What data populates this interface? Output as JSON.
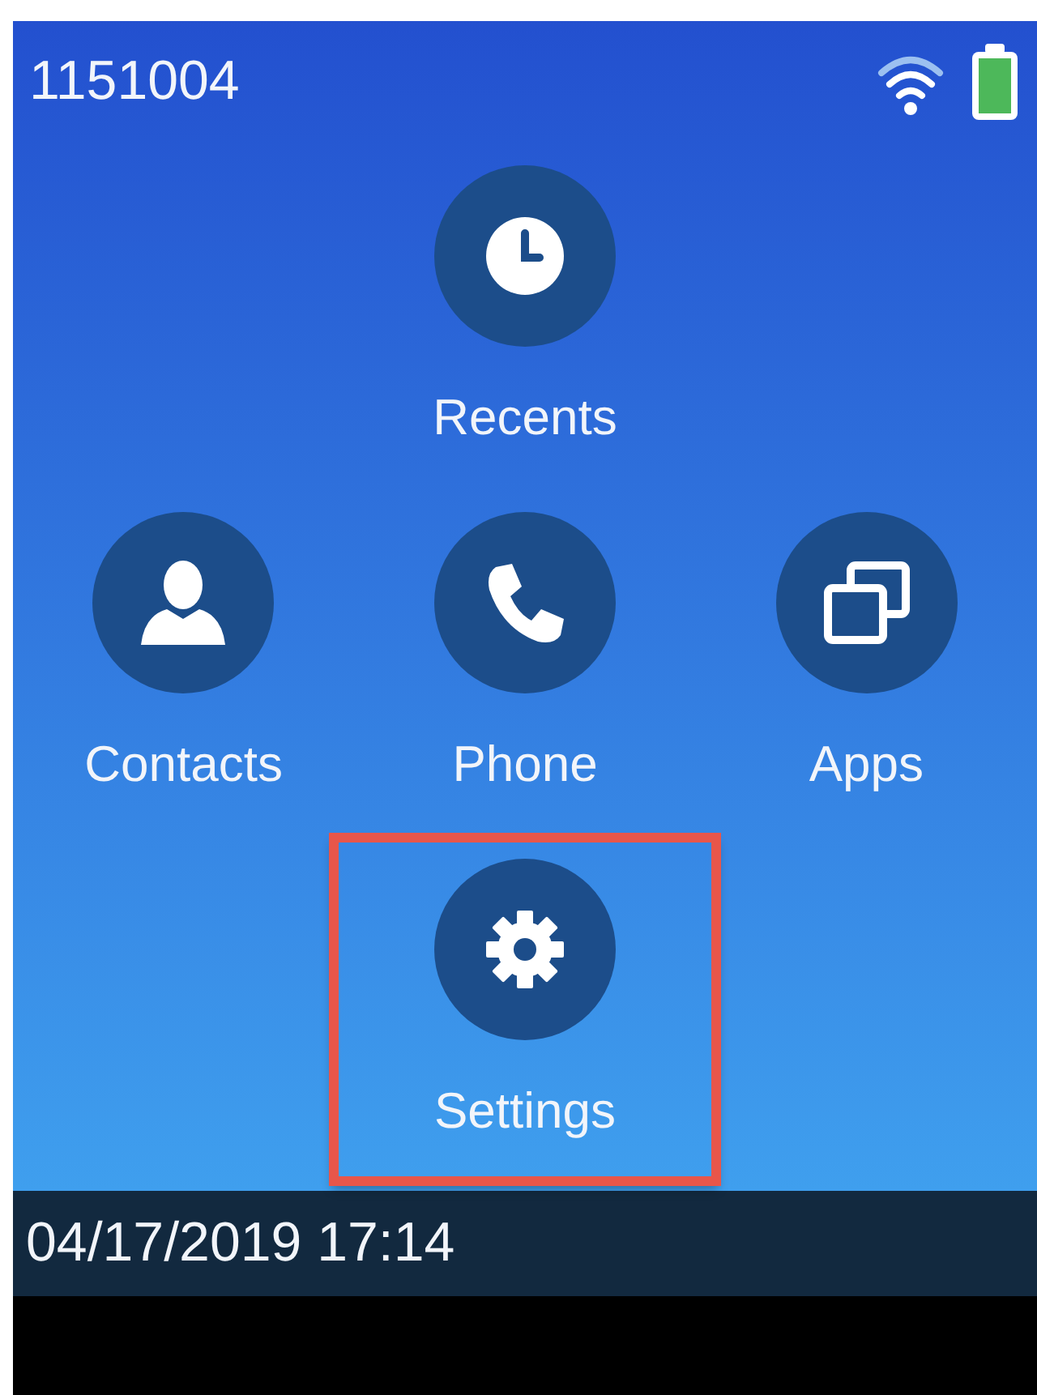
{
  "status_bar": {
    "line_number": "1151004"
  },
  "rows": [
    {
      "items": [
        {
          "label": "Recents",
          "kind": "clock",
          "highlighted": false
        }
      ]
    },
    {
      "items": [
        {
          "label": "Contacts",
          "kind": "person",
          "highlighted": false
        },
        {
          "label": "Phone",
          "kind": "phone",
          "highlighted": false
        },
        {
          "label": "Apps",
          "kind": "windows",
          "highlighted": false
        }
      ]
    },
    {
      "items": [
        {
          "label": "Settings",
          "kind": "gear",
          "highlighted": true
        }
      ]
    }
  ],
  "footer": {
    "datetime": "04/17/2019 17:14"
  }
}
